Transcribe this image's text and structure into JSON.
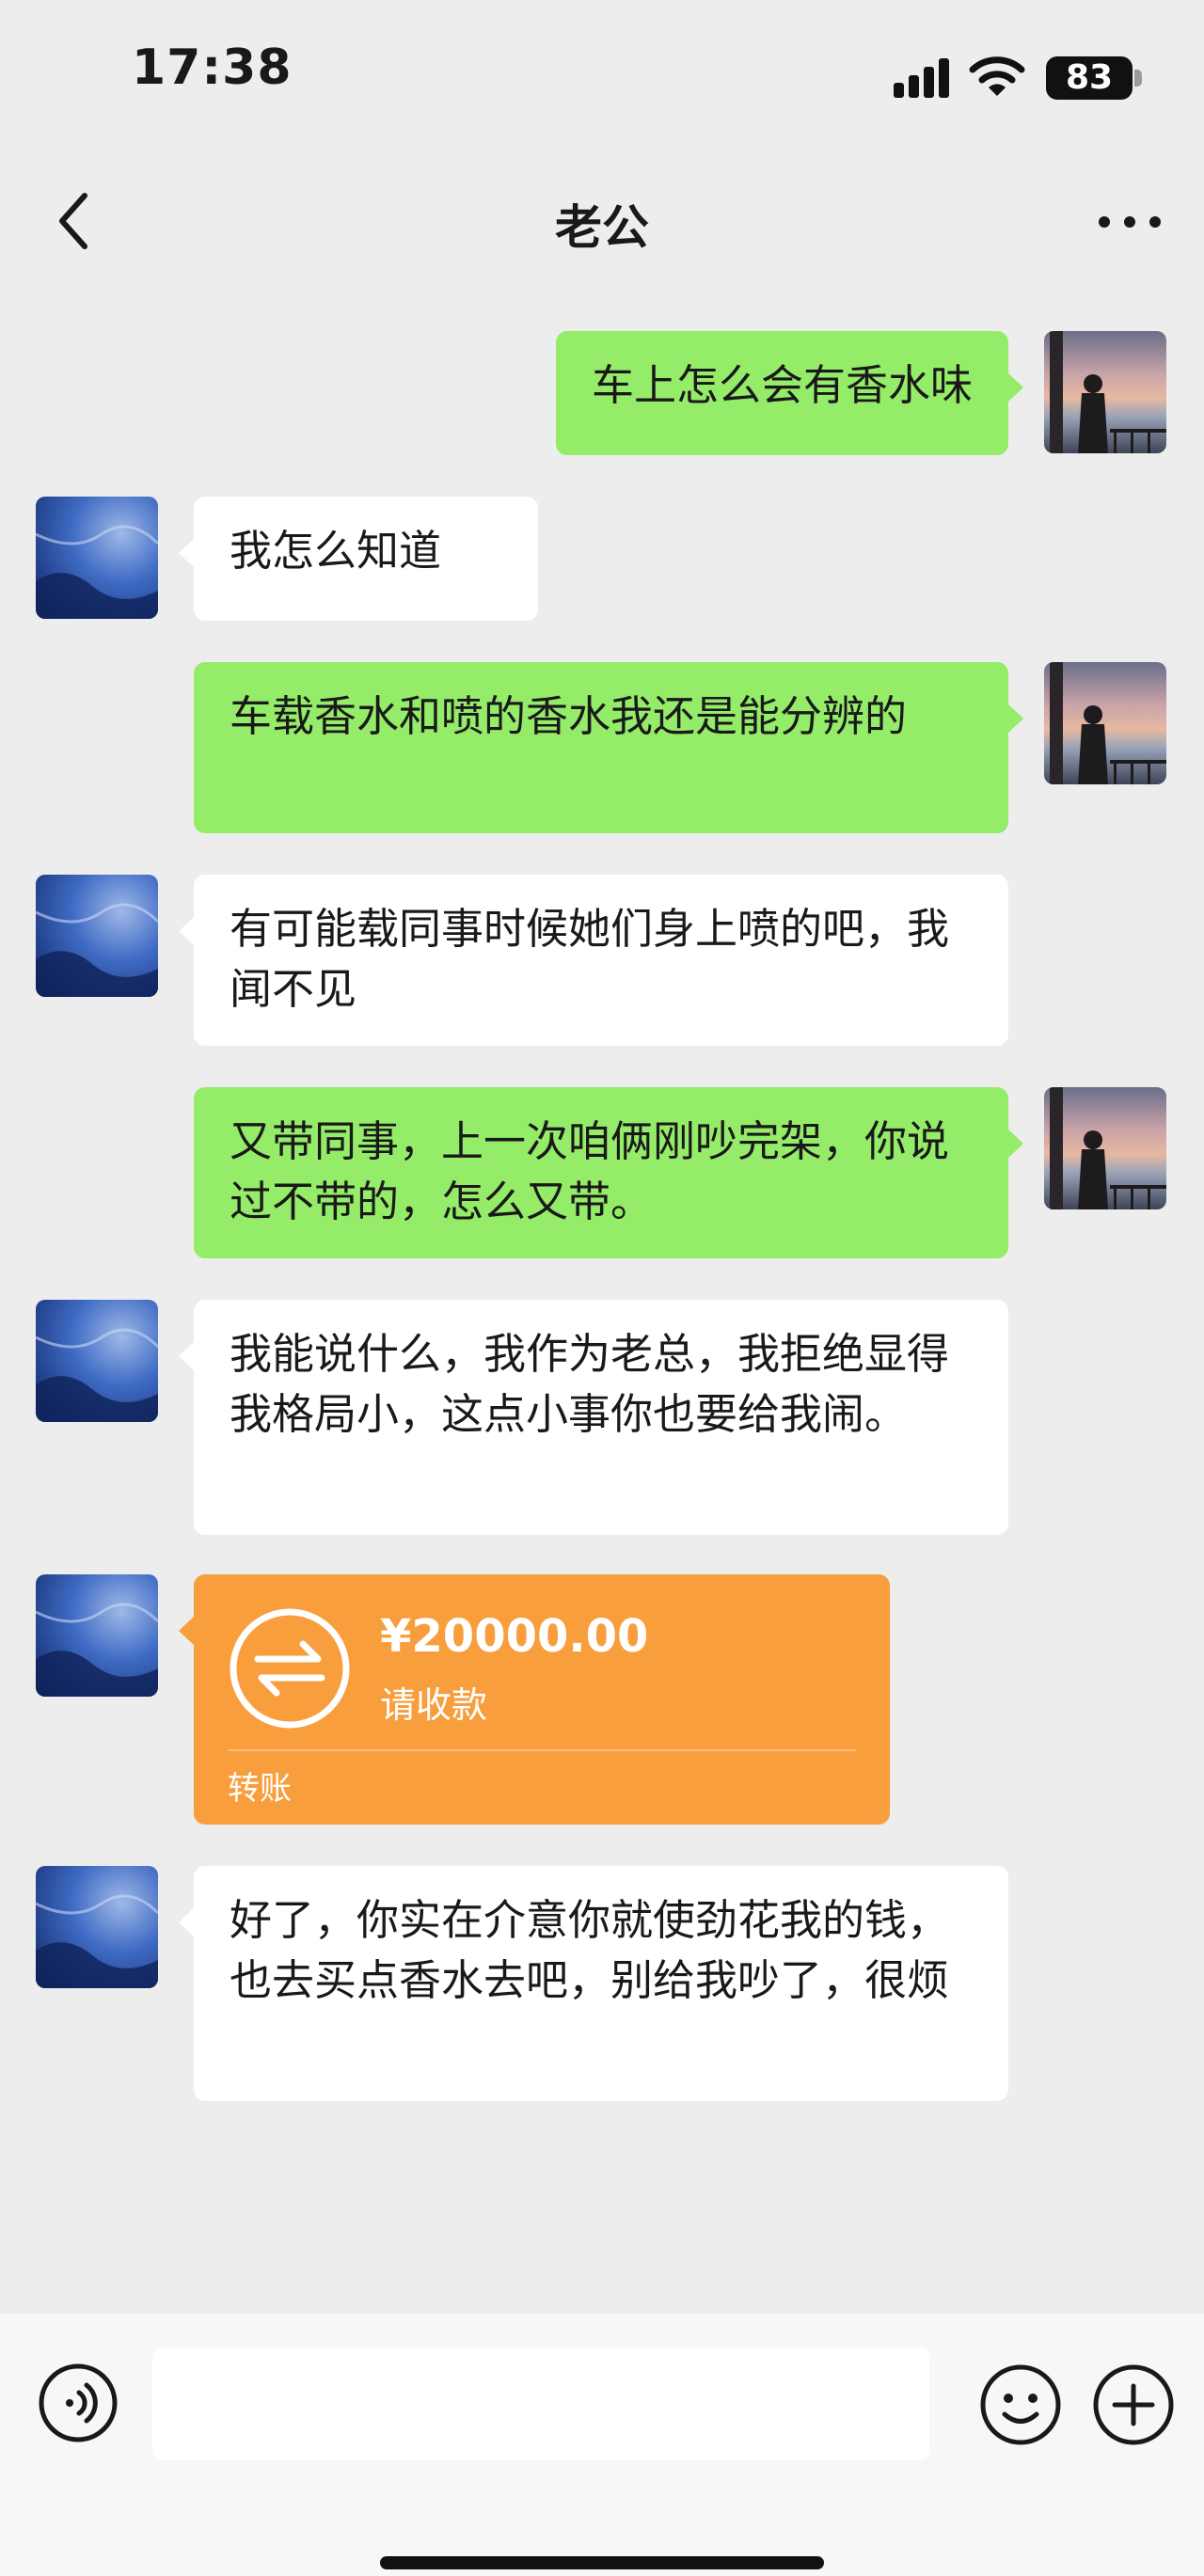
{
  "status_bar": {
    "time": "17:38",
    "battery": "83"
  },
  "header": {
    "title": "老公"
  },
  "messages": [
    {
      "sender": "me",
      "text": "车上怎么会有香水味"
    },
    {
      "sender": "other",
      "text": "我怎么知道"
    },
    {
      "sender": "me",
      "text": "车载香水和喷的香水我还是能分辨的"
    },
    {
      "sender": "other",
      "text": "有可能载同事时候她们身上喷的吧，我闻不见"
    },
    {
      "sender": "me",
      "text": "又带同事，上一次咱俩刚吵完架，你说过不带的，怎么又带。"
    },
    {
      "sender": "other",
      "text": "我能说什么，我作为老总，我拒绝显得我格局小，这点小事你也要给我闹。"
    },
    {
      "sender": "other",
      "text": "好了，你实在介意你就使劲花我的钱，也去买点香水去吧，别给我吵了，很烦"
    }
  ],
  "transfer": {
    "amount": "¥20000.00",
    "note": "请收款",
    "label": "转账"
  },
  "input": {
    "placeholder": ""
  },
  "colors": {
    "my_bubble": "#95ec69",
    "their_bubble": "#ffffff",
    "transfer_card": "#f89e3c",
    "background": "#ededed"
  }
}
